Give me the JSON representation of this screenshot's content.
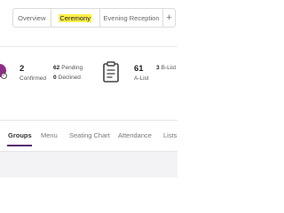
{
  "event_tabs": [
    {
      "label": "Overview"
    },
    {
      "label": "Ceremony"
    },
    {
      "label": "Evening Reception"
    }
  ],
  "add_event_label": "+",
  "active_event_index": 1,
  "stats": {
    "confirmed_count": "2",
    "confirmed_label": "Confirmed",
    "pending_count": "62",
    "pending_label": "Pending",
    "declined_count": "0",
    "declined_label": "Declined",
    "a_list_count": "61",
    "a_list_label": "A-List",
    "b_list_count": "3",
    "b_list_label": "B-List"
  },
  "section_tabs": [
    {
      "label": "Groups"
    },
    {
      "label": "Menu"
    },
    {
      "label": "Seating Chart"
    },
    {
      "label": "Attendance"
    },
    {
      "label": "Lists"
    }
  ],
  "active_section_index": 0,
  "icons": {
    "avatar": "avatar-icon",
    "status": "check-circle-icon",
    "lists": "clipboard-icon",
    "add": "plus-icon"
  },
  "colors": {
    "highlight": "#fff04a",
    "accent": "#5a2a6e",
    "avatar": "#8b2f82"
  }
}
